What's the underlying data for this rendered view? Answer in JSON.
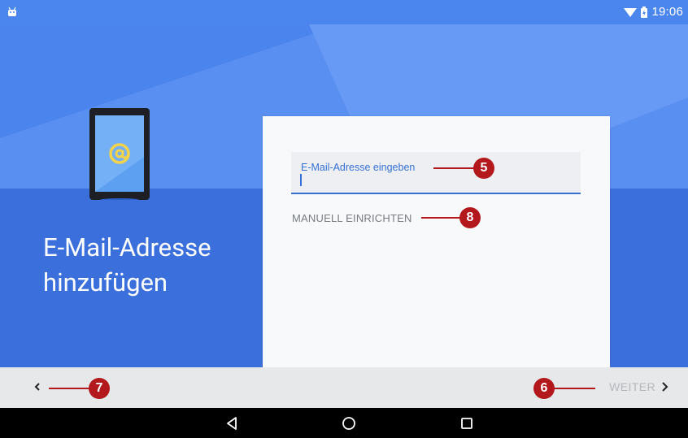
{
  "status_bar": {
    "time": "19:06",
    "icons": [
      "android-icon",
      "wifi-icon",
      "battery-icon"
    ]
  },
  "page": {
    "title": "E-Mail-Adresse hinzufügen",
    "illustration_icon": "at-sign-icon"
  },
  "card": {
    "email_field": {
      "label": "E-Mail-Adresse eingeben",
      "value": ""
    },
    "manual_setup_label": "MANUELL EINRICHTEN"
  },
  "bottom_bar": {
    "back_icon": "chevron-left-icon",
    "next_label": "WEITER",
    "next_icon": "chevron-right-icon"
  },
  "nav_bar": {
    "keys": [
      "back-triangle-icon",
      "home-circle-icon",
      "recents-square-icon"
    ]
  },
  "callouts": {
    "email": "5",
    "next": "6",
    "back": "7",
    "manual": "8"
  },
  "colors": {
    "background": "#3f76e0",
    "status_bar": "#4a86ee",
    "accent": "#3771d6",
    "callout": "#b2181c",
    "bottom_bar": "#e7e8ea"
  }
}
